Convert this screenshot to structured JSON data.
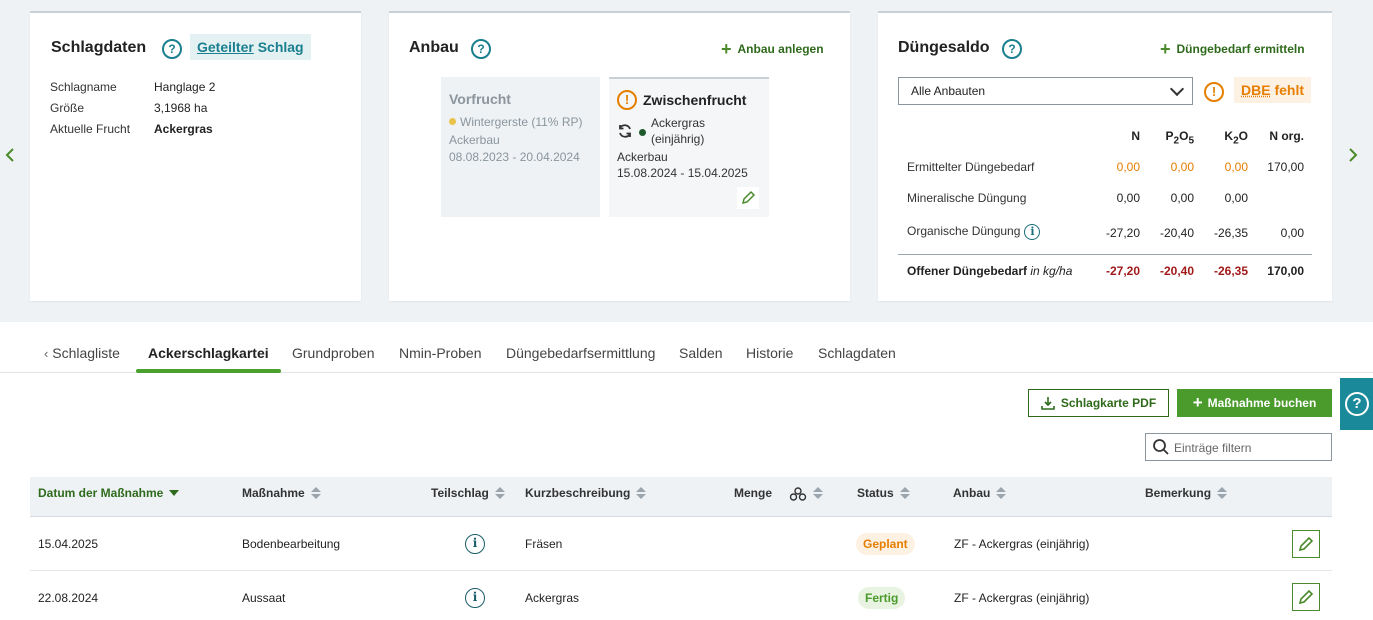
{
  "colors": {
    "accent_green": "#4a9a2c",
    "dark_green": "#2f6a1c",
    "teal": "#1a7f8e",
    "warning_orange": "#e67e00",
    "deficit_red": "#a11a1a"
  },
  "nav": {
    "prev_icon": "chevron-left-icon",
    "next_icon": "chevron-right-icon"
  },
  "schlagdaten": {
    "title": "Schlagdaten",
    "badge_underlined": "Geteilter",
    "badge_rest": "Schlag",
    "rows": [
      {
        "label": "Schlagname",
        "value": "Hanglage 2"
      },
      {
        "label": "Größe",
        "value": "3,1968 ha"
      },
      {
        "label": "Aktuelle Frucht",
        "value": "Ackergras"
      }
    ]
  },
  "anbau": {
    "title": "Anbau",
    "add_label": "Anbau anlegen",
    "vorfrucht": {
      "title": "Vorfrucht",
      "crop": "Wintergerste (11% RP)",
      "type": "Ackerbau",
      "period": "08.08.2023 - 20.04.2024",
      "dot_color": "#e8c24a"
    },
    "zwischenfrucht": {
      "title": "Zwischenfrucht",
      "crop_line1": "Ackergras",
      "crop_line2": "(einjährig)",
      "type": "Ackerbau",
      "period": "15.08.2024 - 15.04.2025",
      "dot_color": "#1e5a2e"
    }
  },
  "duengesaldo": {
    "title": "Düngesaldo",
    "add_label": "Düngebedarf ermitteln",
    "select_value": "Alle Anbauten",
    "badge_underlined": "DBE",
    "badge_rest": "fehlt",
    "columns": [
      "N",
      "P",
      "K",
      "N org."
    ],
    "col_subs": {
      "p_sub1": "2",
      "p_o": "O",
      "p_sub2": "5",
      "k_sub": "2",
      "k_o": "O"
    },
    "rows": [
      {
        "label": "Ermittelter Düngebedarf",
        "values": [
          "0,00",
          "0,00",
          "0,00",
          "170,00"
        ]
      },
      {
        "label": "Mineralische Düngung",
        "values": [
          "0,00",
          "0,00",
          "0,00",
          ""
        ]
      },
      {
        "label": "Organische Düngung",
        "values": [
          "-27,20",
          "-20,40",
          "-26,35",
          "0,00"
        ]
      }
    ],
    "total": {
      "label": "Offener Düngebedarf",
      "unit": "in kg/ha",
      "values": [
        "-27,20",
        "-20,40",
        "-26,35",
        "170,00"
      ]
    }
  },
  "tabs": [
    "Schlagliste",
    "Ackerschlagkartei",
    "Grundproben",
    "Nmin-Proben",
    "Düngebedarfsermittlung",
    "Salden",
    "Historie",
    "Schlagdaten"
  ],
  "actions": {
    "pdf_label": "Schlagkarte PDF",
    "book_label": "Maßnahme buchen",
    "filter_placeholder": "Einträge filtern"
  },
  "table": {
    "headers": [
      "Datum der Maßnahme",
      "Maßnahme",
      "Teilschlag",
      "Kurzbeschreibung",
      "Menge",
      "Status",
      "Anbau",
      "Bemerkung"
    ],
    "rows": [
      {
        "date": "15.04.2025",
        "measure": "Bodenbearbeitung",
        "desc": "Fräsen",
        "status": "Geplant",
        "crop": "ZF - Ackergras (einjährig)"
      },
      {
        "date": "22.08.2024",
        "measure": "Aussaat",
        "desc": "Ackergras",
        "status": "Fertig",
        "crop": "ZF - Ackergras (einjährig)"
      }
    ]
  }
}
